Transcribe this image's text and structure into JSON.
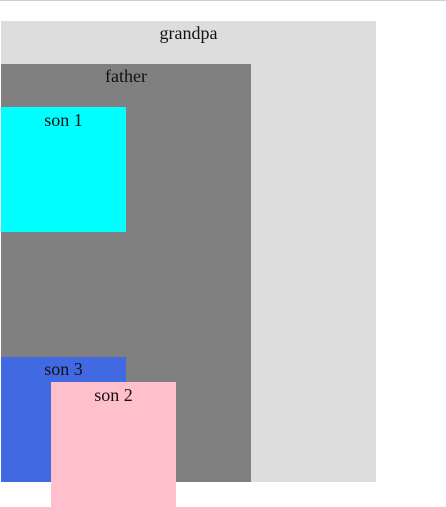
{
  "boxes": {
    "grandpa": {
      "label": "grandpa",
      "color": "#dddddd"
    },
    "father": {
      "label": "father",
      "color": "#808080"
    },
    "son1": {
      "label": "son 1",
      "color": "#00ffff"
    },
    "son2": {
      "label": "son 2",
      "color": "#ffc0cb"
    },
    "son3": {
      "label": "son 3",
      "color": "#4169e1"
    }
  }
}
